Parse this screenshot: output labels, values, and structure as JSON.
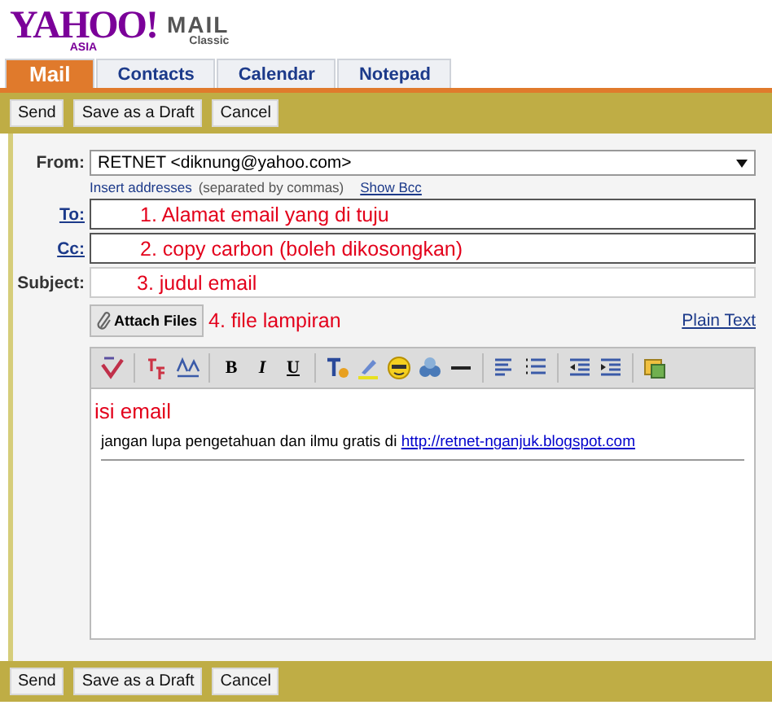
{
  "logo": {
    "brand": "YAHOO!",
    "region": "ASIA",
    "product": "MAIL",
    "edition": "Classic"
  },
  "tabs": [
    {
      "label": "Mail",
      "selected": true
    },
    {
      "label": "Contacts",
      "selected": false
    },
    {
      "label": "Calendar",
      "selected": false
    },
    {
      "label": "Notepad",
      "selected": false
    }
  ],
  "top_buttons": [
    "Send",
    "Save as a Draft",
    "Cancel"
  ],
  "form": {
    "from_label": "From:",
    "from_value": "RETNET <diknung@yahoo.com>",
    "insert_link": "Insert addresses",
    "insert_hint": "(separated by commas)",
    "show_bcc": "Show Bcc",
    "to_label": "To:",
    "to_value": "1. Alamat email yang di tuju",
    "cc_label": "Cc:",
    "cc_value": "2. copy carbon (boleh dikosongkan)",
    "subject_label": "Subject:",
    "subject_value": "3. judul email",
    "attach_button": "Attach Files",
    "attach_note": "4. file lampiran",
    "plain_text": "Plain Text"
  },
  "editor": {
    "format_buttons": [
      {
        "label": "B"
      },
      {
        "label": "I"
      },
      {
        "label": "U"
      }
    ],
    "heading": "isi email",
    "body_text": "jangan lupa pengetahuan dan ilmu gratis di ",
    "body_link": "http://retnet-nganjuk.blogspot.com"
  },
  "bottom_buttons": [
    "Send",
    "Save as a Draft",
    "Cancel"
  ]
}
